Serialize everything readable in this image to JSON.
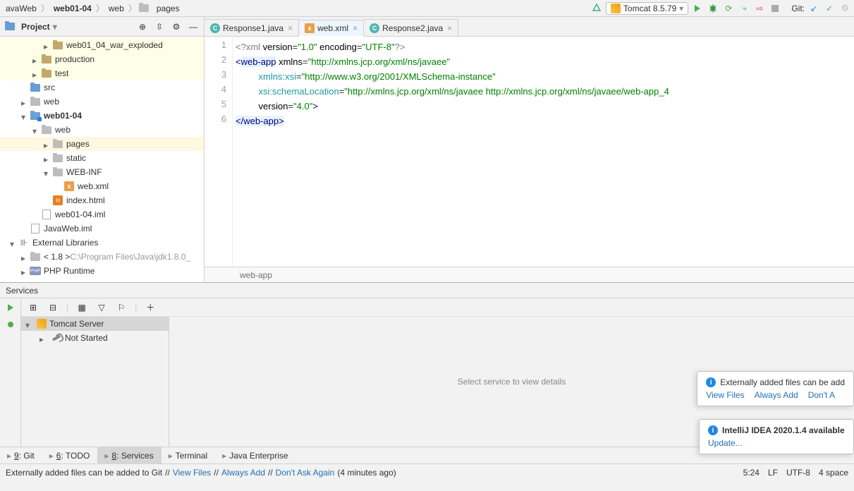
{
  "breadcrumbs": [
    "avaWeb",
    "web01-04",
    "web",
    "pages"
  ],
  "run_config": "Tomcat 8.5.79",
  "git_label": "Git:",
  "project_panel": {
    "title": "Project"
  },
  "tree": [
    {
      "indent": 2,
      "arrow": "right",
      "type": "folder-orange",
      "label": "web01_04_war_exploded",
      "hl": true
    },
    {
      "indent": 1,
      "arrow": "right",
      "type": "folder-orange",
      "label": "production",
      "hl": true
    },
    {
      "indent": 1,
      "arrow": "right",
      "type": "folder-orange",
      "label": "test",
      "hl": true
    },
    {
      "indent": 0,
      "arrow": "none",
      "type": "folder-blue",
      "label": "src"
    },
    {
      "indent": 0,
      "arrow": "right",
      "type": "folder-gray",
      "label": "web"
    },
    {
      "indent": 0,
      "arrow": "down",
      "type": "module",
      "label": "web01-04",
      "bold": true
    },
    {
      "indent": 1,
      "arrow": "down",
      "type": "folder-gray",
      "label": "web"
    },
    {
      "indent": 2,
      "arrow": "right",
      "type": "folder-gray",
      "label": "pages",
      "hl2": true
    },
    {
      "indent": 2,
      "arrow": "right",
      "type": "folder-gray",
      "label": "static"
    },
    {
      "indent": 2,
      "arrow": "down",
      "type": "folder-gray",
      "label": "WEB-INF"
    },
    {
      "indent": 3,
      "arrow": "none",
      "type": "xml",
      "label": "web.xml"
    },
    {
      "indent": 2,
      "arrow": "none",
      "type": "html",
      "label": "index.html"
    },
    {
      "indent": 1,
      "arrow": "none",
      "type": "iml",
      "label": "web01-04.iml"
    },
    {
      "indent": 0,
      "arrow": "none",
      "type": "iml",
      "label": "JavaWeb.iml"
    },
    {
      "indent": -1,
      "arrow": "down",
      "type": "lib",
      "label": "External Libraries"
    },
    {
      "indent": 0,
      "arrow": "right",
      "type": "lib-item",
      "label": "< 1.8 >",
      "extra": "C:\\Program Files\\Java\\jdk1.8.0_"
    },
    {
      "indent": 0,
      "arrow": "right",
      "type": "php",
      "label": "PHP Runtime"
    }
  ],
  "tabs": [
    {
      "icon": "c",
      "label": "Response1.java",
      "active": false
    },
    {
      "icon": "x",
      "label": "web.xml",
      "active": true
    },
    {
      "icon": "c",
      "label": "Response2.java",
      "active": false
    }
  ],
  "code_lines": [
    {
      "n": 1,
      "html": "<span class='pi'>&lt;?xml</span> <span class='attr'>version</span>=<span class='str'>\"1.0\"</span> <span class='attr'>encoding</span>=<span class='str'>\"UTF-8\"</span><span class='pi'>?&gt;</span>"
    },
    {
      "n": 2,
      "html": "<span class='tag'>&lt;</span><span class='endtag-hl'><span class='tag'>web-app</span></span> <span class='attr'>xmlns</span>=<span class='str'>\"http://xmlns.jcp.org/xml/ns/javaee\"</span>"
    },
    {
      "n": 3,
      "html": "&nbsp;&nbsp;&nbsp;&nbsp;&nbsp;&nbsp;&nbsp;&nbsp;&nbsp;<span class='ns'>xmlns:xsi</span>=<span class='str'>\"http://www.w3.org/2001/XMLSchema-instance\"</span>"
    },
    {
      "n": 4,
      "html": "&nbsp;&nbsp;&nbsp;&nbsp;&nbsp;&nbsp;&nbsp;&nbsp;&nbsp;<span class='ns'>xsi:schemaLocation</span>=<span class='str'>\"http://xmlns.jcp.org/xml/ns/javaee http://xmlns.jcp.org/xml/ns/javaee/web-app_4</span>"
    },
    {
      "n": 5,
      "html": "&nbsp;&nbsp;&nbsp;&nbsp;&nbsp;&nbsp;&nbsp;&nbsp;&nbsp;<span class='attr'>version</span>=<span class='str'>\"4.0\"</span><span class='tag'>&gt;</span>"
    },
    {
      "n": 6,
      "html": "<span class='endtag-hl'><span class='tag'>&lt;/web-app&gt;</span></span>"
    }
  ],
  "editor_breadcrumb": "web-app",
  "services": {
    "title": "Services",
    "root": "Tomcat Server",
    "child": "Not Started",
    "placeholder": "Select service to view details"
  },
  "bottom_tabs": [
    {
      "label": "9: Git",
      "u": "9"
    },
    {
      "label": "6: TODO",
      "u": "6"
    },
    {
      "label": "8: Services",
      "u": "8",
      "active": true
    },
    {
      "label": "Terminal"
    },
    {
      "label": "Java Enterprise"
    }
  ],
  "status": {
    "msg_prefix": "Externally added files can be added to Git",
    "links": [
      "View Files",
      "Always Add",
      "Don't Ask Again"
    ],
    "age": "(4 minutes ago)",
    "pos": "5:24",
    "le": "LF",
    "enc": "UTF-8",
    "indent": "4 space"
  },
  "notif1": {
    "title": "Externally added files can be add",
    "links": [
      "View Files",
      "Always Add",
      "Don't A"
    ]
  },
  "notif2": {
    "title": "IntelliJ IDEA 2020.1.4 available",
    "link": "Update..."
  }
}
